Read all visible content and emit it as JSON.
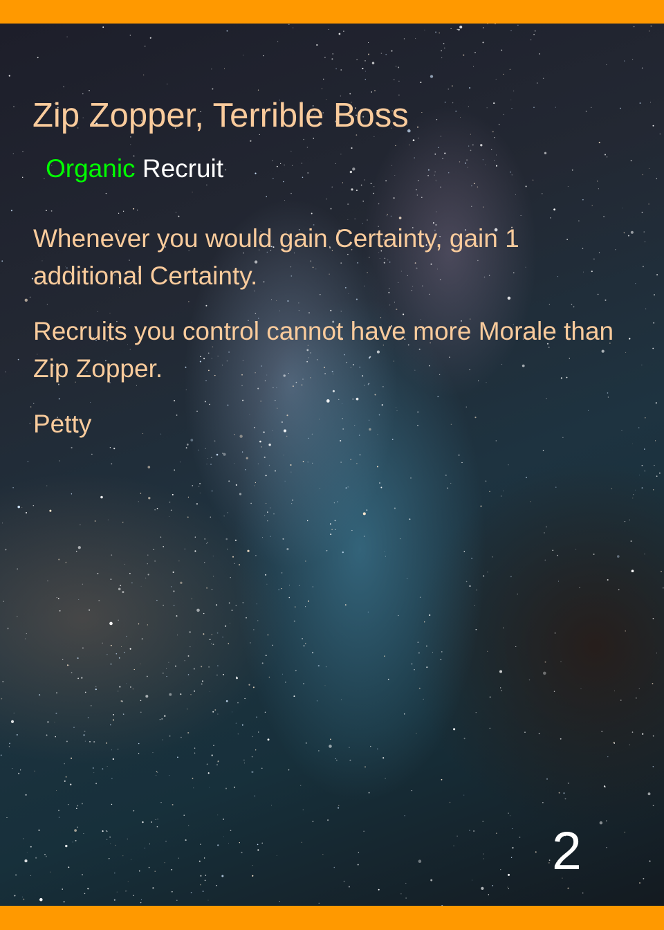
{
  "card": {
    "name": "Zip Zopper, Terrible Boss",
    "type_origin": "Organic",
    "type_kind": "Recruit",
    "rules": [
      "Whenever you would gain Certainty, gain 1 additional Certainty.",
      "Recruits you control cannot have more Morale than Zip Zopper.",
      "Petty"
    ],
    "cost": "2"
  },
  "colors": {
    "border": "#FF9900",
    "text": "#F9CB9C",
    "origin": "#00FF00",
    "kind": "#FFFFFF",
    "cost": "#FFFFFF"
  },
  "art": {
    "subject": "starry-night-sky-milky-way"
  }
}
